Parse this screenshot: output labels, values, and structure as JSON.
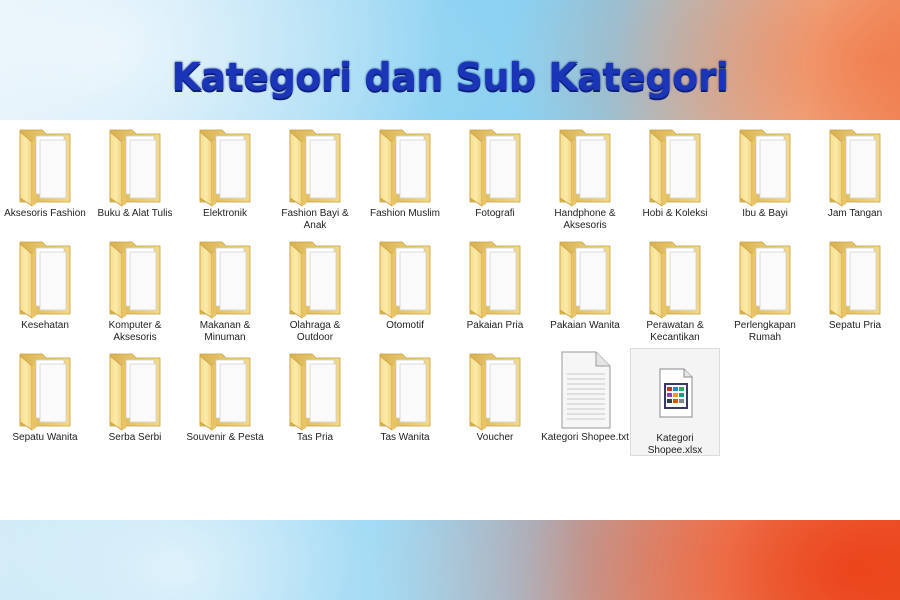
{
  "title": "Kategori dan Sub Kategori",
  "colors": {
    "title": "#1a35b8",
    "folder": "#f2d27a",
    "panel": "#ffffff"
  },
  "files": [
    {
      "label": "Aksesoris Fashion",
      "icon": "folder-icon"
    },
    {
      "label": "Buku & Alat Tulis",
      "icon": "folder-icon"
    },
    {
      "label": "Elektronik",
      "icon": "folder-icon"
    },
    {
      "label": "Fashion Bayi & Anak",
      "icon": "folder-icon"
    },
    {
      "label": "Fashion Muslim",
      "icon": "folder-icon"
    },
    {
      "label": "Fotografi",
      "icon": "folder-icon"
    },
    {
      "label": "Handphone & Aksesoris",
      "icon": "folder-icon"
    },
    {
      "label": "Hobi & Koleksi",
      "icon": "folder-icon"
    },
    {
      "label": "Ibu & Bayi",
      "icon": "folder-icon"
    },
    {
      "label": "Jam Tangan",
      "icon": "folder-icon"
    },
    {
      "label": "Kesehatan",
      "icon": "folder-icon"
    },
    {
      "label": "Komputer & Aksesoris",
      "icon": "folder-icon"
    },
    {
      "label": "Makanan & Minuman",
      "icon": "folder-icon"
    },
    {
      "label": "Olahraga & Outdoor",
      "icon": "folder-icon"
    },
    {
      "label": "Otomotif",
      "icon": "folder-icon"
    },
    {
      "label": "Pakaian Pria",
      "icon": "folder-icon"
    },
    {
      "label": "Pakaian Wanita",
      "icon": "folder-icon"
    },
    {
      "label": "Perawatan & Kecantikan",
      "icon": "folder-icon"
    },
    {
      "label": "Perlengkapan Rumah",
      "icon": "folder-icon"
    },
    {
      "label": "Sepatu Pria",
      "icon": "folder-icon"
    },
    {
      "label": "Sepatu Wanita",
      "icon": "folder-icon"
    },
    {
      "label": "Serba Serbi",
      "icon": "folder-icon"
    },
    {
      "label": "Souvenir & Pesta",
      "icon": "folder-icon"
    },
    {
      "label": "Tas Pria",
      "icon": "folder-icon"
    },
    {
      "label": "Tas Wanita",
      "icon": "folder-icon"
    },
    {
      "label": "Voucher",
      "icon": "folder-icon"
    },
    {
      "label": "Kategori Shopee.txt",
      "icon": "text-file-icon"
    },
    {
      "label": "Kategori Shopee.xlsx",
      "icon": "spreadsheet-file-icon",
      "selected": true
    }
  ]
}
